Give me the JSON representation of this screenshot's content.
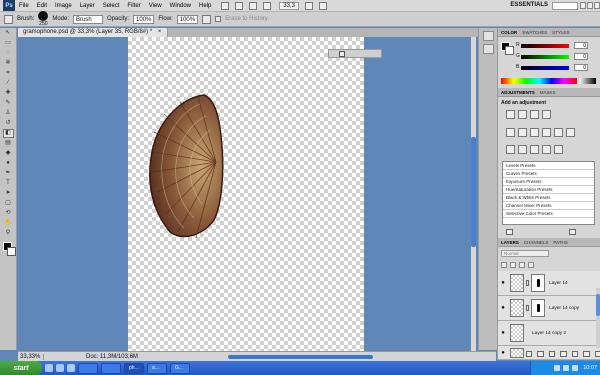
{
  "menubar": {
    "logo": "Ps",
    "items": [
      "File",
      "Edit",
      "Image",
      "Layer",
      "Select",
      "Filter",
      "View",
      "Window",
      "Help"
    ],
    "zoom": "33,3",
    "workspace": "ESSENTIALS"
  },
  "options": {
    "brush_label": "Brush:",
    "brush_size": "250",
    "mode_label": "Mode:",
    "mode_value": "Brush",
    "opacity_label": "Opacity:",
    "opacity_value": "100%",
    "flow_label": "Flow:",
    "flow_value": "100%",
    "erase_history": "Erase to History"
  },
  "document": {
    "tab_title": "gramophone.psd @ 33,3% (Layer 35, RGB/8#) *",
    "close": "×"
  },
  "status": {
    "zoom": "33,33%",
    "doc_info": "Doc: 11,3M/103,6M"
  },
  "color_panel": {
    "tabs": [
      "COLOR",
      "SWATCHES",
      "STYLES"
    ],
    "sliders": [
      {
        "letter": "R",
        "value": "0",
        "color": "#ff0000"
      },
      {
        "letter": "G",
        "value": "0",
        "color": "#00ff00"
      },
      {
        "letter": "B",
        "value": "0",
        "color": "#0000ff"
      }
    ]
  },
  "adjustments": {
    "tabs": [
      "ADJUSTMENTS",
      "MASKS"
    ],
    "title": "Add an adjustment",
    "presets": [
      "Levels Presets",
      "Curves Presets",
      "Exposure Presets",
      "Hue/Saturation Presets",
      "Black & White Presets",
      "Channel Mixer Presets",
      "Selective Color Presets"
    ]
  },
  "layers": {
    "tabs": [
      "LAYERS",
      "CHANNELS",
      "PATHS"
    ],
    "blend_mode": "Normal",
    "rows": [
      {
        "name": "Layer 14",
        "mask": true
      },
      {
        "name": "Layer 14 copy",
        "mask": true
      },
      {
        "name": "Layer 14 copy 2",
        "mask": false
      },
      {
        "name": "",
        "mask": true
      }
    ]
  },
  "taskbar": {
    "start": "start",
    "tasks": [
      "",
      "",
      "ph...",
      "a...",
      "G..."
    ],
    "clock": "10:07"
  },
  "colors": {
    "workspace_bg": "#5f88b8",
    "accent_blue": "#3b76d0"
  },
  "icons": [
    "ps-logo-icon",
    "brush-icon",
    "eye-icon",
    "chain-icon",
    "start-icon"
  ]
}
